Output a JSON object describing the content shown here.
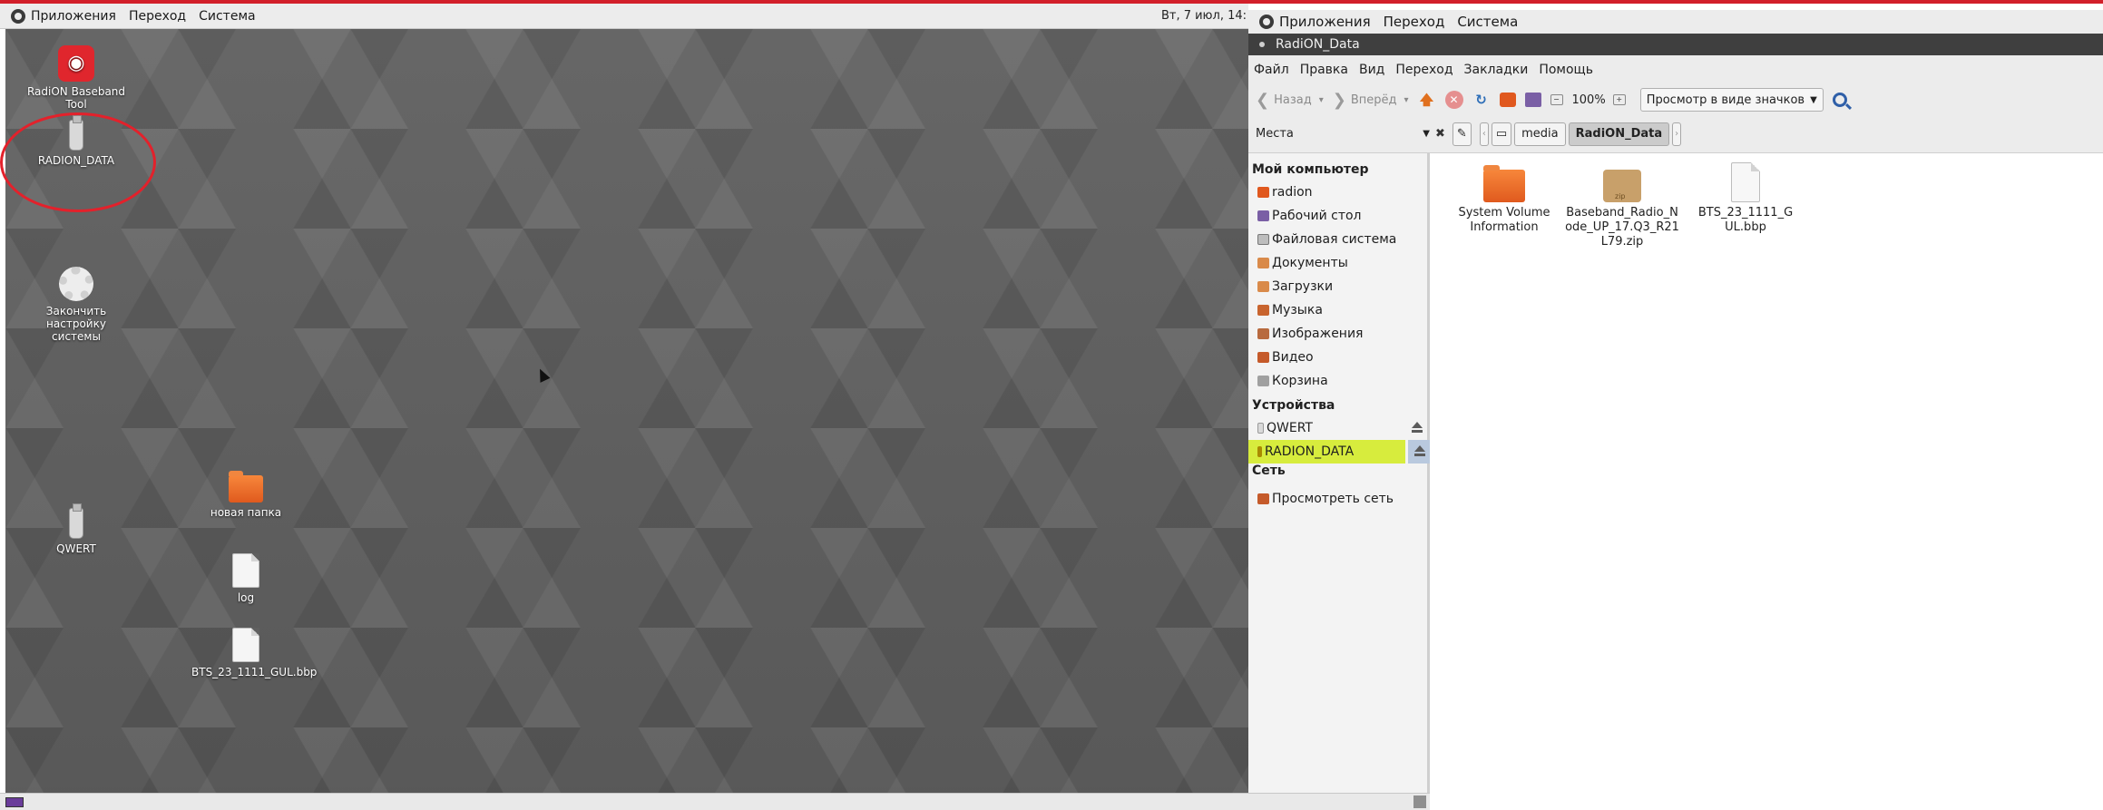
{
  "left_screen": {
    "panel": {
      "menus": [
        "Приложения",
        "Переход",
        "Система"
      ],
      "clock": "Вт, 7 июл, 14:"
    },
    "desktop_icons": {
      "radion": "RadiON Baseband Tool",
      "radion_data": "RADION_DATA",
      "finish_setup": "Закончить настройку системы",
      "qwert": "QWERT",
      "new_folder": "новая папка",
      "log": "log",
      "bts_file": "BTS_23_1111_GUL.bbp"
    }
  },
  "right_screen": {
    "panel": {
      "menus": [
        "Приложения",
        "Переход",
        "Система"
      ]
    },
    "window_title": "RadiON_Data",
    "menubar": [
      "Файл",
      "Правка",
      "Вид",
      "Переход",
      "Закладки",
      "Помощь"
    ],
    "toolbar": {
      "back": "Назад",
      "forward": "Вперёд",
      "zoom": "100%",
      "view_mode": "Просмотр в виде значков"
    },
    "location": {
      "places_label": "Места",
      "path": [
        "media",
        "RadiON_Data"
      ]
    },
    "sidebar": {
      "computer_heading": "Мой компьютер",
      "computer_items": [
        "radion",
        "Рабочий стол",
        "Файловая система",
        "Документы",
        "Загрузки",
        "Музыка",
        "Изображения",
        "Видео",
        "Корзина"
      ],
      "devices_heading": "Устройства",
      "devices": [
        "QWERT",
        "RADION_DATA"
      ],
      "network_heading": "Сеть",
      "network_items": [
        "Просмотреть сеть"
      ]
    },
    "files": [
      {
        "name": "System Volume Information",
        "kind": "folder"
      },
      {
        "name": "Baseband_Radio_Node_UP_17.Q3_R21L79.zip",
        "kind": "zip"
      },
      {
        "name": "BTS_23_1111_GUL.bbp",
        "kind": "file"
      }
    ]
  },
  "colors": {
    "highlight": "#d7ec3d",
    "annotation_circle": "#e3212b",
    "radion_brand": "#e0262d"
  }
}
